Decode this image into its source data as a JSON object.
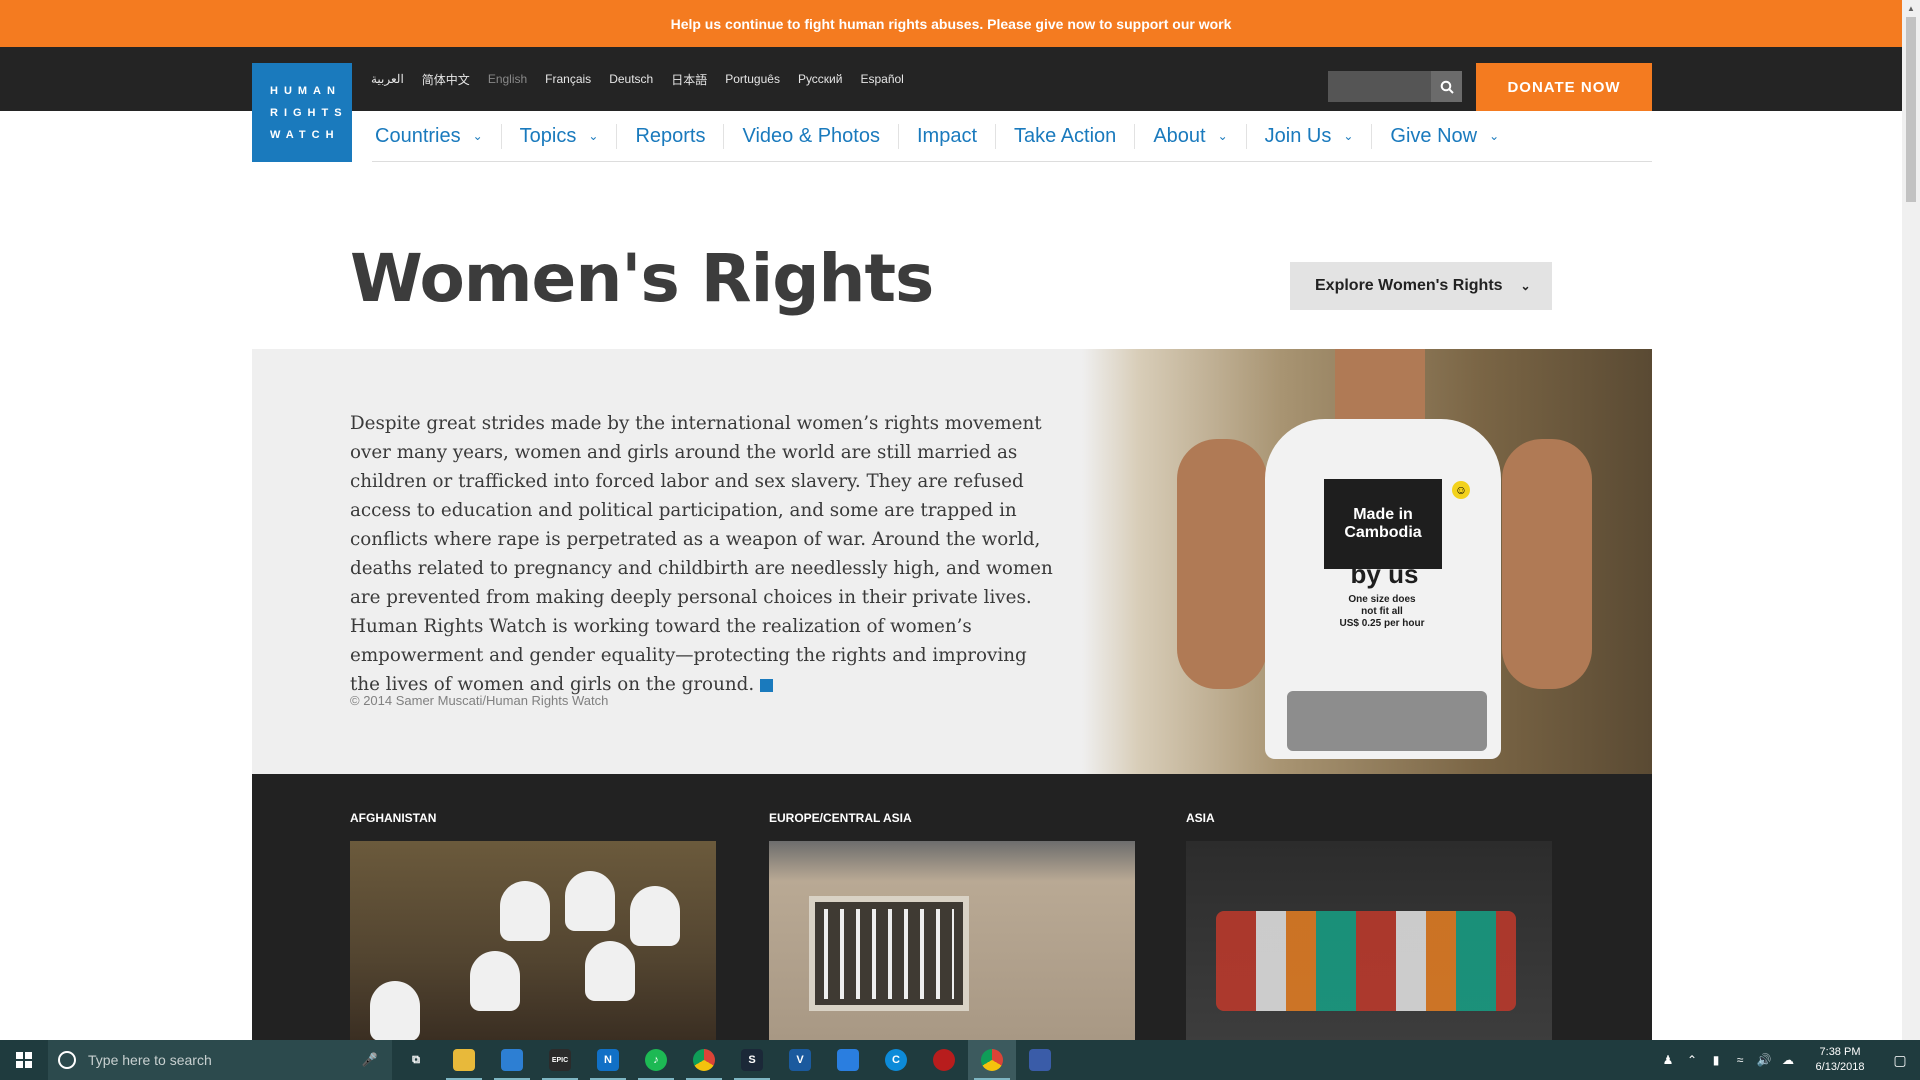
{
  "banner": {
    "text": "Help us continue to fight human rights abuses. Please give now to support our work"
  },
  "logo": {
    "lines": [
      "HUMAN",
      "RIGHTS",
      "WATCH"
    ]
  },
  "languages": [
    {
      "label": "العربية",
      "current": false
    },
    {
      "label": "简体中文",
      "current": false
    },
    {
      "label": "English",
      "current": true
    },
    {
      "label": "Français",
      "current": false
    },
    {
      "label": "Deutsch",
      "current": false
    },
    {
      "label": "日本語",
      "current": false
    },
    {
      "label": "Português",
      "current": false
    },
    {
      "label": "Русский",
      "current": false
    },
    {
      "label": "Español",
      "current": false
    }
  ],
  "search": {
    "placeholder": ""
  },
  "donate": {
    "label": "DONATE NOW"
  },
  "nav": [
    {
      "label": "Countries",
      "dropdown": true
    },
    {
      "label": "Topics",
      "dropdown": true
    },
    {
      "label": "Reports",
      "dropdown": false
    },
    {
      "label": "Video & Photos",
      "dropdown": false
    },
    {
      "label": "Impact",
      "dropdown": false
    },
    {
      "label": "Take Action",
      "dropdown": false
    },
    {
      "label": "About",
      "dropdown": true
    },
    {
      "label": "Join Us",
      "dropdown": true
    },
    {
      "label": "Give Now",
      "dropdown": true
    }
  ],
  "page": {
    "title": "Women's Rights",
    "explore_label": "Explore Women's Rights"
  },
  "hero": {
    "text": "Despite great strides made by the international women’s rights movement over many years, women and girls around the world are still married as children or trafficked into forced labor and sex slavery. They are refused access to education and political participation, and some are trapped in conflicts where rape is perpetrated as a weapon of war. Around the world, deaths related to pregnancy and childbirth are needlessly high, and women are prevented from making deeply personal choices in their private lives. Human Rights Watch is working toward the realization of women’s empowerment and gender equality—protecting the rights and improving the lives of women and girls on the ground.",
    "credit": "© 2014 Samer Muscati/Human Rights Watch",
    "shirt_label": [
      "Made in",
      "Cambodia"
    ],
    "shirt_byus": "by us",
    "shirt_fit": [
      "One size does",
      "not fit all",
      "US$ 0.25 per hour"
    ]
  },
  "cards": [
    {
      "region": "AFGHANISTAN"
    },
    {
      "region": "EUROPE/CENTRAL ASIA"
    },
    {
      "region": "ASIA"
    }
  ],
  "taskbar": {
    "search_placeholder": "Type here to search",
    "apps": [
      {
        "name": "task-view-icon",
        "glyph": "⧉",
        "color": "transparent"
      },
      {
        "name": "file-explorer-icon",
        "glyph": "",
        "color": "#e8b93a"
      },
      {
        "name": "store-icon",
        "glyph": "",
        "color": "#2d7fd3"
      },
      {
        "name": "epic-games-icon",
        "glyph": "EPIC",
        "color": "#2b2b2b"
      },
      {
        "name": "notes-app-icon",
        "glyph": "N",
        "color": "#1170c6"
      },
      {
        "name": "spotify-icon",
        "glyph": "♪",
        "color": "#1db954"
      },
      {
        "name": "chrome-icon",
        "glyph": "",
        "color": "#db4437"
      },
      {
        "name": "steam-icon",
        "glyph": "S",
        "color": "#1b2838"
      },
      {
        "name": "vpn-app-icon",
        "glyph": "V",
        "color": "#1b5a9e"
      },
      {
        "name": "shield-app-icon",
        "glyph": "",
        "color": "#2a7ee0"
      },
      {
        "name": "sync-app-icon",
        "glyph": "C",
        "color": "#0d8bd9"
      },
      {
        "name": "game-app-icon",
        "glyph": "",
        "color": "#b81d1d"
      },
      {
        "name": "chrome-active-icon",
        "glyph": "",
        "color": "#db4437"
      },
      {
        "name": "document-app-icon",
        "glyph": "",
        "color": "#3a5ca8"
      }
    ],
    "time": "7:38 PM",
    "date": "6/13/2018"
  }
}
